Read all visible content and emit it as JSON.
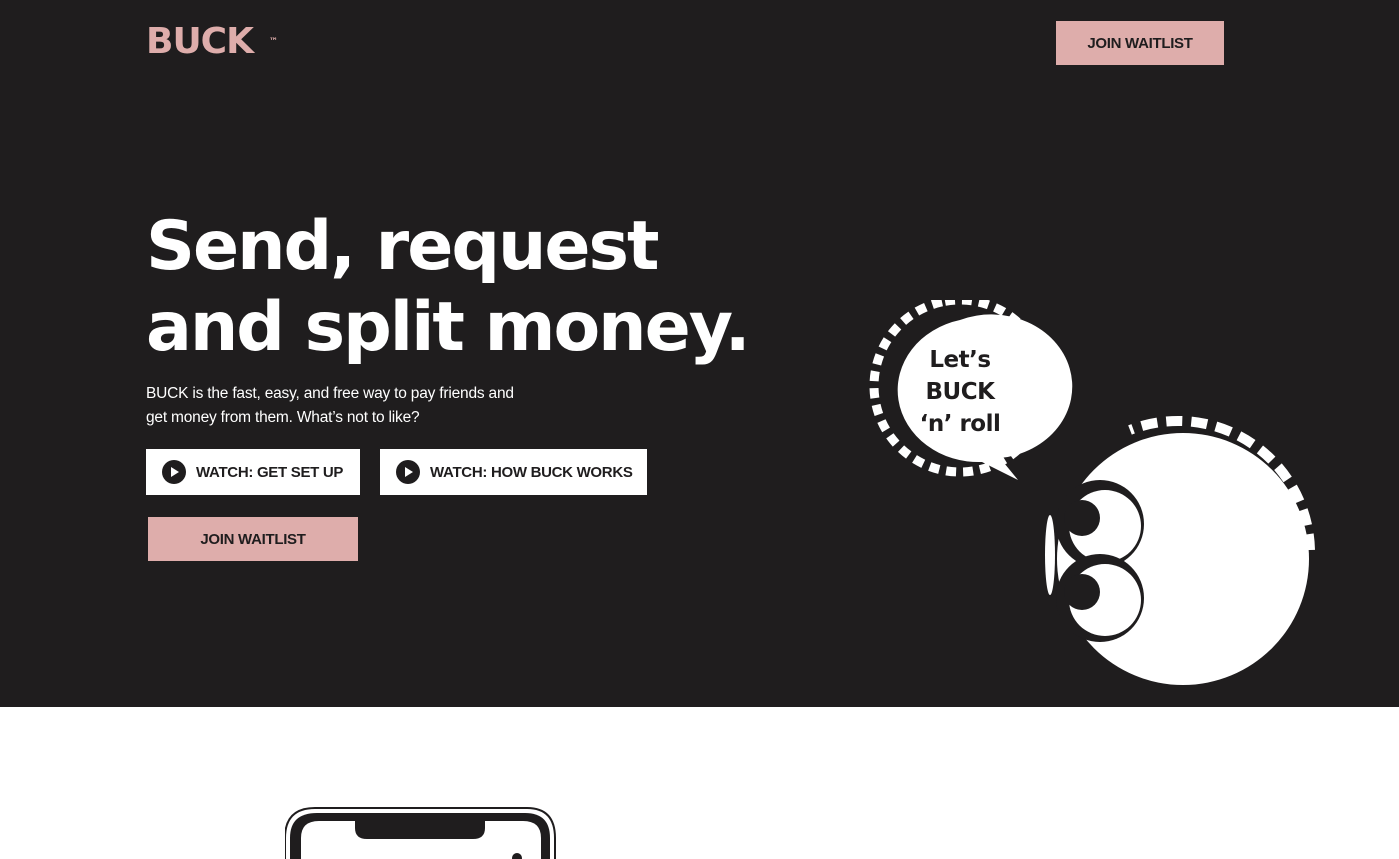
{
  "brand": {
    "logo_text": "BUCK",
    "trademark": "™",
    "accent_color": "#deadab",
    "dark_color": "#1f1d1e"
  },
  "nav": {
    "join_label": "JOIN WAITLIST"
  },
  "hero": {
    "headline_line1": "Send, request",
    "headline_line2": "and split money.",
    "subcopy": "BUCK is the fast, easy, and free way to pay friends and get money from them. What’s not to like?",
    "watch_setup_label": "WATCH: GET SET UP",
    "watch_works_label": "WATCH: HOW BUCK WORKS",
    "join_label": "JOIN WAITLIST"
  },
  "mascot": {
    "bubble_line1": "Let’s",
    "bubble_line2": "BUCK",
    "bubble_line3": "‘n’ roll"
  },
  "icons": {
    "play": "play-icon",
    "mascot": "coin-mascot",
    "bubble": "speech-bubble",
    "phone": "phone-mockup"
  }
}
